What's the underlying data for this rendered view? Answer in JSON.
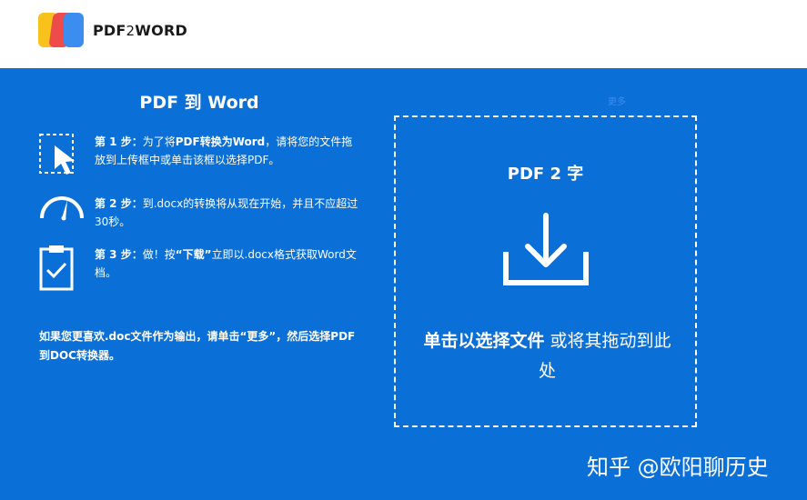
{
  "header": {
    "logo_text_a": "PDF",
    "logo_text_b": "2",
    "logo_text_c": "WORD"
  },
  "left": {
    "title": "PDF 到 Word",
    "steps": [
      {
        "label": "第 1 步：",
        "text_a": "为了将",
        "bold": "PDF转换为Word",
        "text_b": "，请将您的文件拖放到上传框中或单击该框以选择PDF。",
        "icon": "cursor-select-icon"
      },
      {
        "label": "第 2 步：",
        "text_a": "到.docx的转换将从现在开始，并且不应超过30秒。",
        "icon": "speedometer-icon"
      },
      {
        "label": "第 3 步：",
        "text_a": "做！按",
        "bold": "“下载”",
        "text_b": "立即以.docx格式获取Word文档。",
        "icon": "clipboard-check-icon"
      }
    ],
    "note": "如果您更喜欢.doc文件作为输出，请单击“更多”，然后选择PDF到DOC转换器。"
  },
  "dropzone": {
    "title": "PDF 2 字",
    "bold_text": "单击以选择文件",
    "rest_text": " 或将其拖动到此处",
    "icon": "download-icon"
  },
  "tiny_link": "更多",
  "watermark": "知乎 @欧阳聊历史",
  "colors": {
    "background": "#0b6fd8",
    "header": "#ffffff",
    "text": "#ffffff"
  }
}
